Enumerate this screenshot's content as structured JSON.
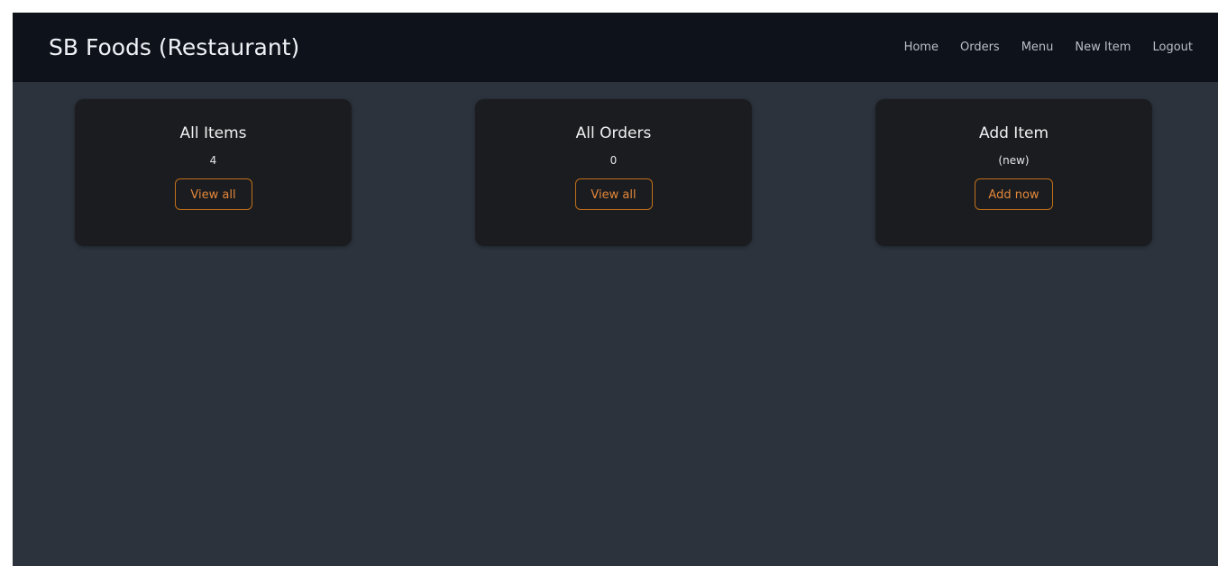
{
  "app": {
    "brand": "SB Foods (Restaurant)"
  },
  "nav": {
    "items": [
      "Home",
      "Orders",
      "Menu",
      "New Item",
      "Logout"
    ]
  },
  "cards": [
    {
      "title": "All Items",
      "value": "4",
      "button": "View all"
    },
    {
      "title": "All Orders",
      "value": "0",
      "button": "View all"
    },
    {
      "title": "Add Item",
      "value": "(new)",
      "button": "Add now"
    }
  ],
  "colors": {
    "navbar_bg": "#0e131b",
    "page_bg": "#2c333d",
    "card_bg": "#1b1c1f",
    "accent": "#c1701a"
  }
}
